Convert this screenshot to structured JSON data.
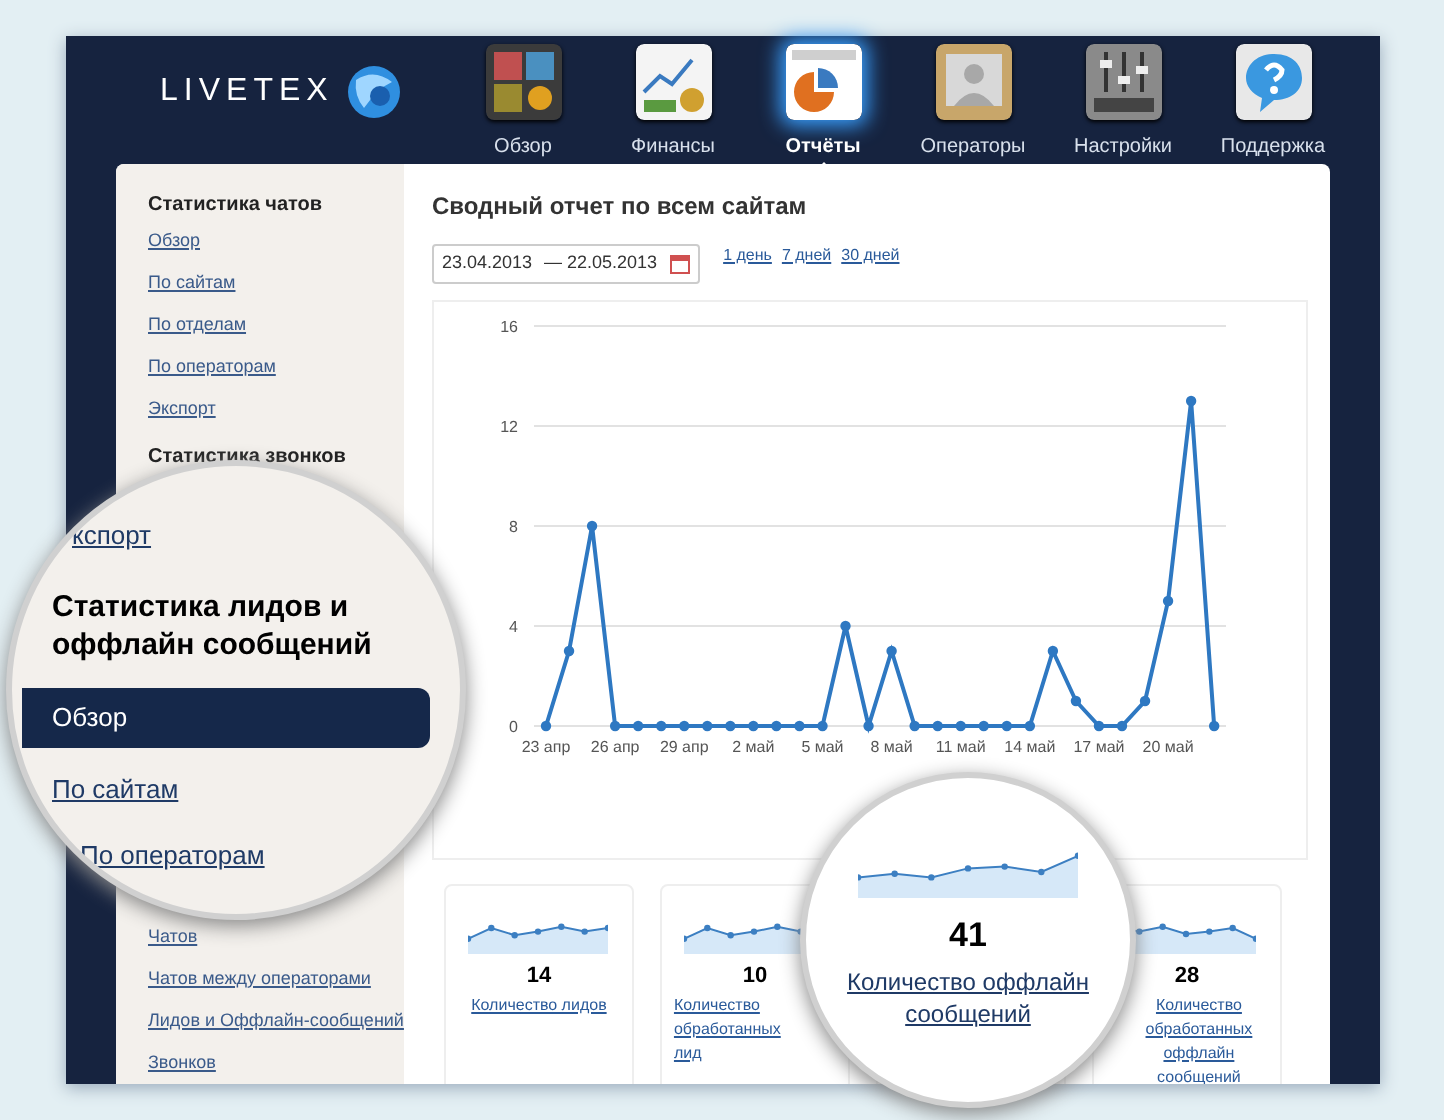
{
  "header": {
    "logo": "LIVETEX",
    "nav": [
      {
        "label": "Обзор",
        "selected": false
      },
      {
        "label": "Финансы",
        "selected": false
      },
      {
        "label": "Отчёты",
        "selected": true
      },
      {
        "label": "Операторы",
        "selected": false
      },
      {
        "label": "Настройки",
        "selected": false
      },
      {
        "label": "Поддержка",
        "selected": false
      }
    ]
  },
  "sidebar": {
    "top": [
      {
        "kind": "heading",
        "label": "Статистика чатов"
      },
      {
        "kind": "link",
        "label": "Обзор"
      },
      {
        "kind": "link",
        "label": "По сайтам"
      },
      {
        "kind": "link",
        "label": "По отделам"
      },
      {
        "kind": "link",
        "label": "По операторам"
      },
      {
        "kind": "link",
        "label": "Экспорт"
      },
      {
        "kind": "heading",
        "label": "Статистика звонков"
      }
    ],
    "bottom": [
      {
        "kind": "link",
        "label": "Чатов"
      },
      {
        "kind": "link",
        "label": "Чатов между операторами"
      },
      {
        "kind": "link",
        "label": "Лидов и Оффлайн-сообщений"
      },
      {
        "kind": "link",
        "label": "Звонков"
      }
    ]
  },
  "sidebar_magnifier": {
    "items": [
      {
        "kind": "link",
        "label": "кспорт",
        "selected": false
      },
      {
        "kind": "heading",
        "label": "Статистика лидов и оффлайн сообщений"
      },
      {
        "kind": "link",
        "label": "Обзор",
        "selected": true
      },
      {
        "kind": "link",
        "label": "По сайтам",
        "selected": false
      },
      {
        "kind": "link",
        "label": "По операторам",
        "selected": false
      }
    ]
  },
  "main": {
    "title": "Сводный отчет по всем сайтам",
    "date_from": "23.04.2013",
    "date_to": "— 22.05.2013",
    "periods": [
      "1 день",
      "7 дней",
      "30 дней"
    ],
    "chart_data": {
      "type": "line",
      "categories": [
        "23 апр",
        null,
        null,
        "26 апр",
        null,
        null,
        "29 апр",
        null,
        null,
        "2 май",
        null,
        null,
        "5 май",
        null,
        null,
        "8 май",
        null,
        null,
        "11 май",
        null,
        null,
        "14 май",
        null,
        null,
        "17 май",
        null,
        null,
        "20 май",
        null,
        null
      ],
      "grid": true,
      "series": [
        {
          "color": "#2e78c2",
          "marker": "circle",
          "values": [
            0,
            3,
            8,
            0,
            0,
            0,
            0,
            0,
            0,
            0,
            0,
            0,
            0,
            4,
            0,
            3,
            0,
            0,
            0,
            0,
            0,
            0,
            3,
            1,
            0,
            0,
            1,
            5,
            13,
            0
          ]
        }
      ],
      "ylim": [
        0,
        16
      ],
      "yticks": [
        0,
        4,
        8,
        12,
        16
      ]
    },
    "cards": [
      {
        "value": "14",
        "label": "Количество лидов"
      },
      {
        "value": "10",
        "label": "Количество обработанных лид"
      },
      {
        "value": "28",
        "label": "Количество обработанных оффлайн сообщений"
      }
    ],
    "card_magnifier": {
      "value": "41",
      "label": "Количество оффлайн сообщений"
    }
  }
}
